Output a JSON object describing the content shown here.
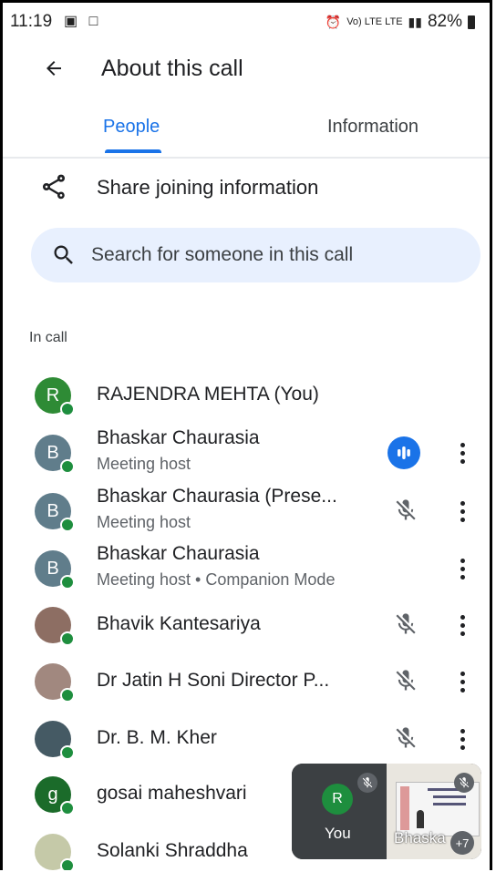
{
  "status_bar": {
    "time": "11:19",
    "network_labels": "Vo) LTE  LTE",
    "battery": "82%"
  },
  "header": {
    "title": "About this call"
  },
  "tabs": [
    {
      "label": "People",
      "active": true
    },
    {
      "label": "Information",
      "active": false
    }
  ],
  "share": {
    "label": "Share joining information"
  },
  "search": {
    "placeholder": "Search for someone in this call"
  },
  "section": {
    "label": "In call"
  },
  "participants": [
    {
      "initial": "R",
      "color": "#2e8b35",
      "name": "RAJENDRA MEHTA (You)",
      "subtitle": "",
      "mic": "none",
      "more": false
    },
    {
      "initial": "B",
      "color": "#607d8b",
      "name": "Bhaskar Chaurasia",
      "subtitle": "Meeting host",
      "mic": "speaking",
      "more": true
    },
    {
      "initial": "B",
      "color": "#607d8b",
      "name": "Bhaskar Chaurasia (Prese...",
      "subtitle": "Meeting host",
      "mic": "muted",
      "more": true
    },
    {
      "initial": "B",
      "color": "#607d8b",
      "name": "Bhaskar Chaurasia",
      "subtitle": "Meeting host • Companion Mode",
      "mic": "none",
      "more": true
    },
    {
      "initial": "",
      "color": "#8d6e63",
      "name": "Bhavik Kantesariya",
      "subtitle": "",
      "mic": "muted",
      "more": true
    },
    {
      "initial": "",
      "color": "#a1887f",
      "name": "Dr Jatin H Soni Director P...",
      "subtitle": "",
      "mic": "muted",
      "more": true
    },
    {
      "initial": "",
      "color": "#455a64",
      "name": "Dr. B. M. Kher",
      "subtitle": "",
      "mic": "muted",
      "more": true
    },
    {
      "initial": "g",
      "color": "#1b6b2a",
      "name": "gosai maheshvari",
      "subtitle": "",
      "mic": "none",
      "more": false
    },
    {
      "initial": "",
      "color": "#c5c9a8",
      "name": "Solanki Shraddha",
      "subtitle": "",
      "mic": "none",
      "more": false
    }
  ],
  "pip": {
    "you_initial": "R",
    "you_label": "You",
    "share_label": "Bhaska",
    "extra_count": "+7"
  }
}
